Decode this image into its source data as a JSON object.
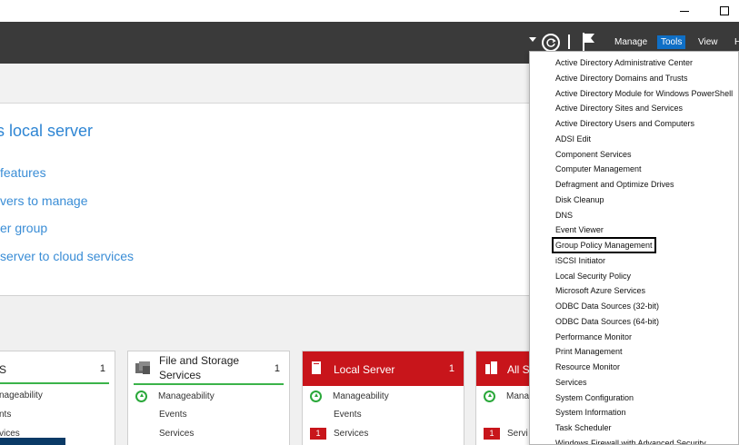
{
  "toolbar": {
    "menus": [
      "Manage",
      "Tools",
      "View",
      "H"
    ]
  },
  "welcome": {
    "title": "s local server",
    "links": [
      "features",
      "vers to manage",
      "er group",
      "server to cloud services"
    ]
  },
  "tiles": [
    {
      "title": "S",
      "count": "1",
      "rows": [
        "nageability",
        "nts",
        "vices"
      ]
    },
    {
      "title_line1": "File and Storage",
      "title_line2": "Services",
      "count": "1",
      "rows": [
        "Manageability",
        "Events",
        "Services"
      ]
    },
    {
      "title": "Local Server",
      "count": "1",
      "rows": [
        "Manageability",
        "Events",
        "Services"
      ],
      "badge": "1"
    },
    {
      "title": "All S",
      "rows": [
        "Mana",
        "",
        "Servi"
      ],
      "badge": "1"
    }
  ],
  "tools_menu": {
    "items": [
      "Active Directory Administrative Center",
      "Active Directory Domains and Trusts",
      "Active Directory Module for Windows PowerShell",
      "Active Directory Sites and Services",
      "Active Directory Users and Computers",
      "ADSI Edit",
      "Component Services",
      "Computer Management",
      "Defragment and Optimize Drives",
      "Disk Cleanup",
      "DNS",
      "Event Viewer",
      "Group Policy Management",
      "iSCSI Initiator",
      "Local Security Policy",
      "Microsoft Azure Services",
      "ODBC Data Sources (32-bit)",
      "ODBC Data Sources (64-bit)",
      "Performance Monitor",
      "Print Management",
      "Resource Monitor",
      "Services",
      "System Configuration",
      "System Information",
      "Task Scheduler",
      "Windows Firewall with Advanced Security"
    ],
    "highlighted": "Group Policy Management"
  },
  "colors": {
    "toolbar_bg": "#3a3a3a",
    "tools_active": "#0f6fc6",
    "link_blue": "#3a8dd6",
    "status_green": "#3bb34a",
    "alert_red": "#c8151b"
  }
}
